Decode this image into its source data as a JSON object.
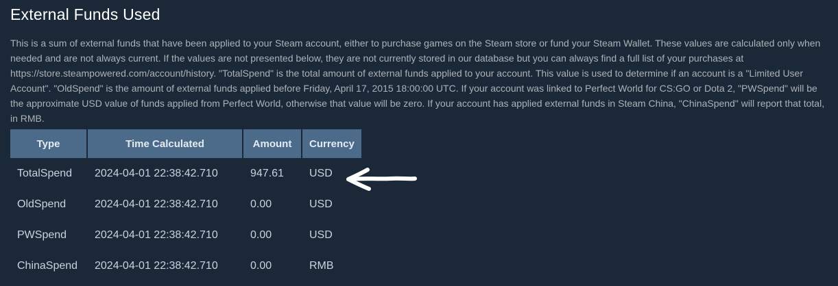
{
  "title": "External Funds Used",
  "description": "This is a sum of external funds that have been applied to your Steam account, either to purchase games on the Steam store or fund your Steam Wallet. These values are calculated only when needed and are not always current. If the values are not presented below, they are not currently stored in our database but you can always find a full list of your purchases at https://store.steampowered.com/account/history. \"TotalSpend\" is the total amount of external funds applied to your account. This value is used to determine if an account is a \"Limited User Account\". \"OldSpend\" is the amount of external funds applied before Friday, April 17, 2015 18:00:00 UTC. If your account was linked to Perfect World for CS:GO or Dota 2, \"PWSpend\" will be the approximate USD value of funds applied from Perfect World, otherwise that value will be zero. If your account has applied external funds in Steam China, \"ChinaSpend\" will report that total, in RMB.",
  "table": {
    "headers": [
      "Type",
      "Time Calculated",
      "Amount",
      "Currency"
    ],
    "rows": [
      {
        "type": "TotalSpend",
        "time": "2024-04-01 22:38:42.710",
        "amount": "947.61",
        "currency": "USD"
      },
      {
        "type": "OldSpend",
        "time": "2024-04-01 22:38:42.710",
        "amount": "0.00",
        "currency": "USD"
      },
      {
        "type": "PWSpend",
        "time": "2024-04-01 22:38:42.710",
        "amount": "0.00",
        "currency": "USD"
      },
      {
        "type": "ChinaSpend",
        "time": "2024-04-01 22:38:42.710",
        "amount": "0.00",
        "currency": "RMB"
      }
    ]
  },
  "annotation": {
    "icon": "hand-drawn-arrow-left-icon",
    "color": "#ffffff"
  },
  "colors": {
    "background": "#1b2838",
    "header_bg": "#4c6b8a",
    "text": "#c6d4df",
    "title": "#ffffff"
  }
}
